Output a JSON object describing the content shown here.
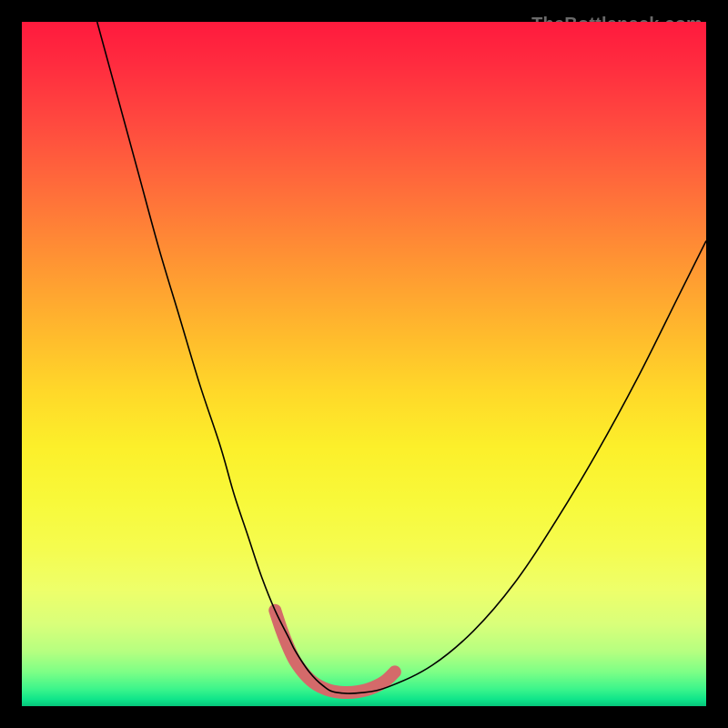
{
  "watermark": "TheBottleneck.com",
  "chart_data": {
    "type": "line",
    "title": "",
    "xlabel": "",
    "ylabel": "",
    "xlim": [
      0,
      100
    ],
    "ylim": [
      0,
      100
    ],
    "series": [
      {
        "name": "bottleneck-curve",
        "x": [
          11,
          14,
          17,
          20,
          23,
          26,
          29,
          31,
          33,
          35,
          37,
          39,
          40,
          42,
          44,
          46,
          50,
          54,
          60,
          66,
          72,
          78,
          84,
          90,
          96,
          100
        ],
        "y": [
          100,
          89,
          78,
          67,
          57,
          47,
          38,
          31,
          25,
          19,
          14,
          10,
          8,
          5,
          3,
          2,
          2,
          3,
          6,
          11,
          18,
          27,
          37,
          48,
          60,
          68
        ],
        "color": "#000000",
        "thickness_px": 1.6
      },
      {
        "name": "highlight-u",
        "x": [
          37.0,
          38.0,
          39.0,
          40.0,
          41.5,
          43.0,
          45.0,
          47.0,
          49.0,
          51.0,
          53.0,
          54.5
        ],
        "y": [
          14.0,
          11.0,
          8.5,
          6.5,
          4.5,
          3.2,
          2.3,
          2.0,
          2.1,
          2.6,
          3.6,
          5.0
        ],
        "color": "#d46a6a",
        "thickness_px": 14,
        "linecap": "round"
      }
    ]
  }
}
